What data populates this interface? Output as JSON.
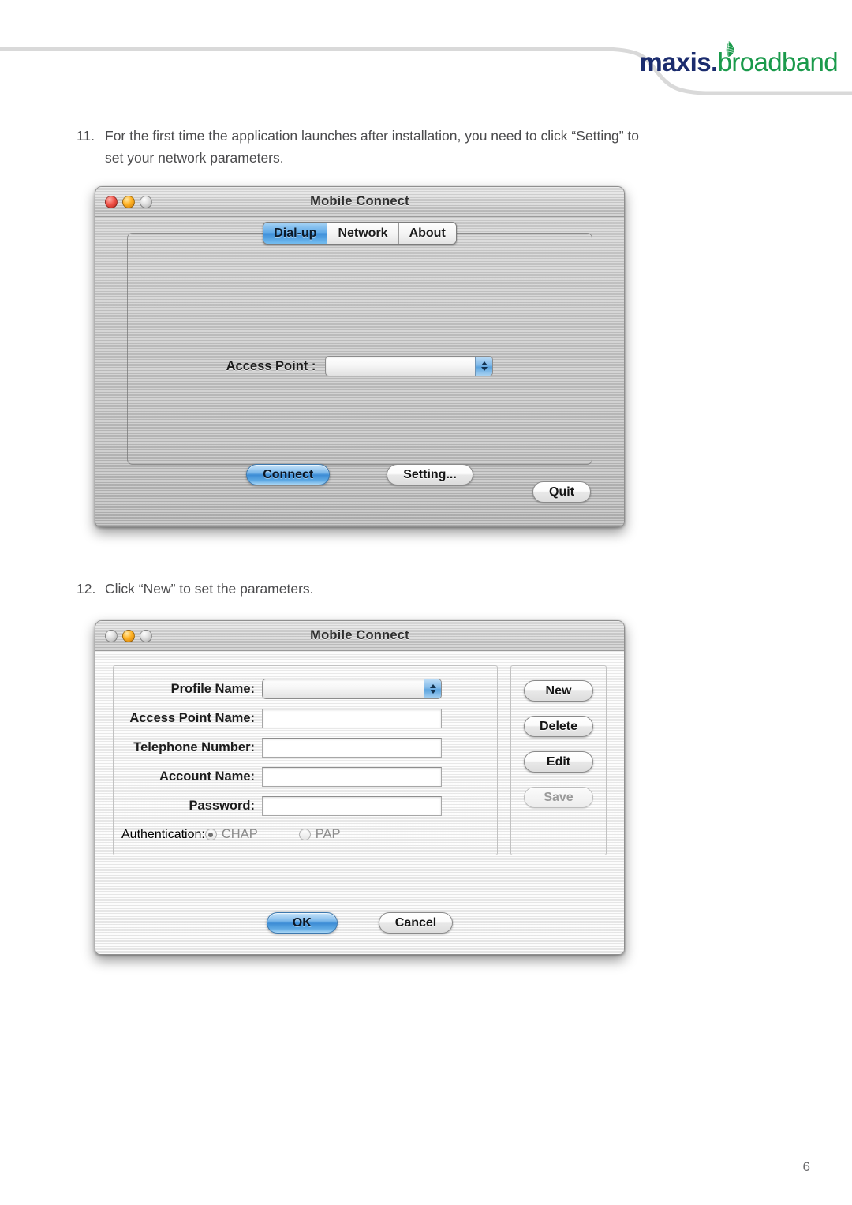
{
  "header": {
    "logo": {
      "brand": "maxis",
      "dot": ".",
      "product": "broadband",
      "brand_color": "#1b2c6e",
      "product_color": "#1a9a4b",
      "swoosh_color": "#d8d8d8",
      "leaf_icon": "maxis-leaf-icon"
    }
  },
  "steps": [
    {
      "number": "11.",
      "text": "For the first time the application launches after installation, you need to click “Setting”  to set your network parameters."
    },
    {
      "number": "12.",
      "text": "Click “New” to set the parameters."
    }
  ],
  "dialup_window": {
    "title": "Mobile Connect",
    "traffic_lights": [
      "close-red",
      "minimize-yellow",
      "zoom-gray"
    ],
    "tabs": [
      {
        "label": "Dial-up",
        "active": true
      },
      {
        "label": "Network",
        "active": false
      },
      {
        "label": "About",
        "active": false
      }
    ],
    "access_point": {
      "label": "Access Point :",
      "value": "",
      "placeholder": ""
    },
    "buttons": {
      "connect": "Connect",
      "setting": "Setting...",
      "quit": "Quit"
    }
  },
  "profile_window": {
    "title": "Mobile Connect",
    "traffic_lights": [
      "close-gray",
      "minimize-yellow",
      "zoom-gray"
    ],
    "fields": [
      {
        "label": "Profile Name:",
        "type": "combo",
        "value": ""
      },
      {
        "label": "Access Point Name:",
        "type": "text",
        "value": ""
      },
      {
        "label": "Telephone Number:",
        "type": "text",
        "value": ""
      },
      {
        "label": "Account Name:",
        "type": "text",
        "value": ""
      },
      {
        "label": "Password:",
        "type": "text",
        "value": ""
      }
    ],
    "authentication": {
      "label": "Authentication:",
      "options": [
        {
          "label": "CHAP",
          "selected": true
        },
        {
          "label": "PAP",
          "selected": false
        }
      ]
    },
    "side_buttons": [
      {
        "label": "New",
        "disabled": false
      },
      {
        "label": "Delete",
        "disabled": false
      },
      {
        "label": "Edit",
        "disabled": false
      },
      {
        "label": "Save",
        "disabled": true
      }
    ],
    "footer_buttons": {
      "ok": "OK",
      "cancel": "Cancel"
    }
  },
  "footer": {
    "page_number": "6"
  }
}
